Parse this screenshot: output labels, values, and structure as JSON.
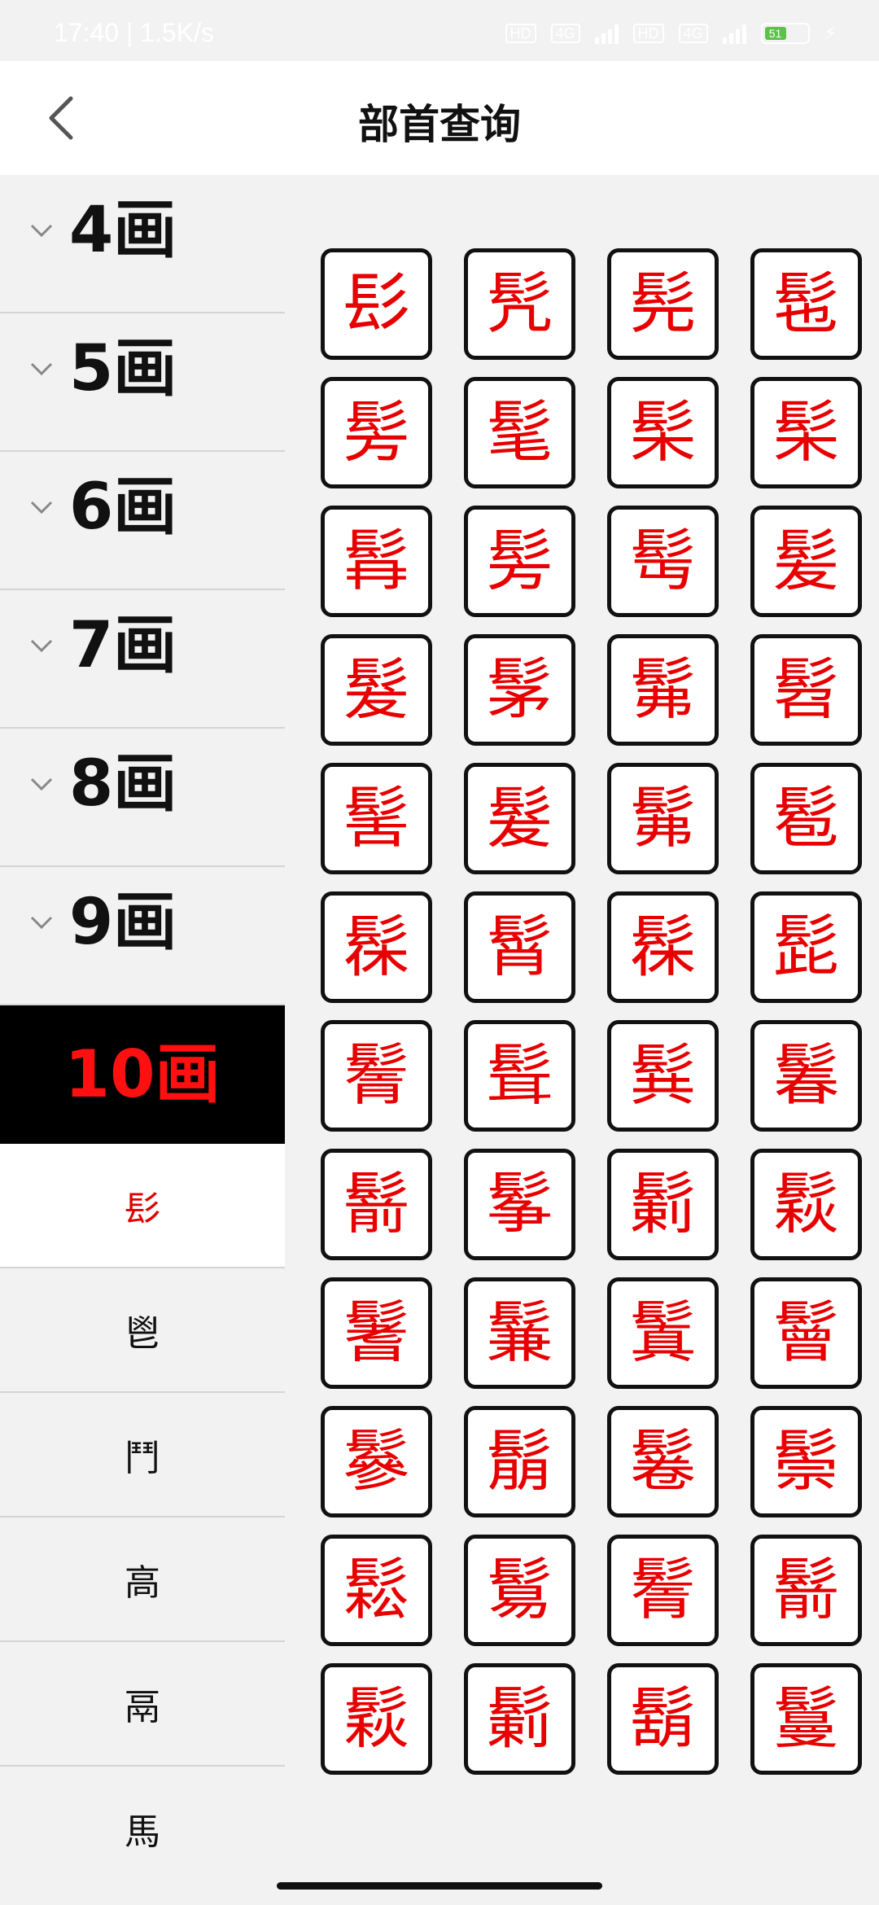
{
  "status_bar": {
    "time": "17:40 | 1.5K/s",
    "hd1": "HD",
    "net1": "4G",
    "hd2": "HD",
    "net2": "4G",
    "battery": "51"
  },
  "header": {
    "title": "部首查询"
  },
  "sidebar": {
    "groups": [
      {
        "label": "4画"
      },
      {
        "label": "5画"
      },
      {
        "label": "6画"
      },
      {
        "label": "7画"
      },
      {
        "label": "8画"
      },
      {
        "label": "9画"
      },
      {
        "label": "10画"
      }
    ],
    "radicals": [
      "髟",
      "鬯",
      "鬥",
      "高",
      "鬲",
      "馬"
    ]
  },
  "characters": [
    "髟",
    "髠",
    "髡",
    "髢",
    "髣",
    "髦",
    "髤",
    "髤",
    "髥",
    "髣",
    "髩",
    "髪",
    "髮",
    "髳",
    "髴",
    "髫",
    "髺",
    "髮",
    "髴",
    "髱",
    "髹",
    "髾",
    "髹",
    "髭",
    "鬌",
    "髶",
    "髸",
    "鬊",
    "鬋",
    "鬇",
    "鬎",
    "鬏",
    "鬐",
    "鬑",
    "鬒",
    "鬙",
    "鬖",
    "鬅",
    "鬈",
    "鬃",
    "鬆",
    "鬄",
    "鬌",
    "鬋",
    "鬏",
    "鬎",
    "鬍",
    "鬘"
  ]
}
